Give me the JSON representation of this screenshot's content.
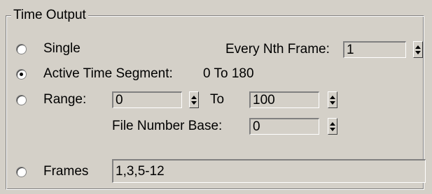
{
  "group": {
    "title": "Time Output"
  },
  "single": {
    "label": "Single",
    "selected": false
  },
  "every_nth": {
    "label": "Every Nth Frame:",
    "value": "1"
  },
  "active_segment": {
    "label": "Active Time Segment:",
    "value_text": "0 To 180",
    "selected": true
  },
  "range": {
    "label": "Range:",
    "from_value": "0",
    "to_label": "To",
    "to_value": "100",
    "selected": false
  },
  "file_number_base": {
    "label": "File Number Base:",
    "value": "0"
  },
  "frames": {
    "label": "Frames",
    "value": "1,3,5-12",
    "selected": false
  },
  "icons": {
    "radio": "radio-button-icon",
    "spinner": "spinner-arrows-icon"
  }
}
